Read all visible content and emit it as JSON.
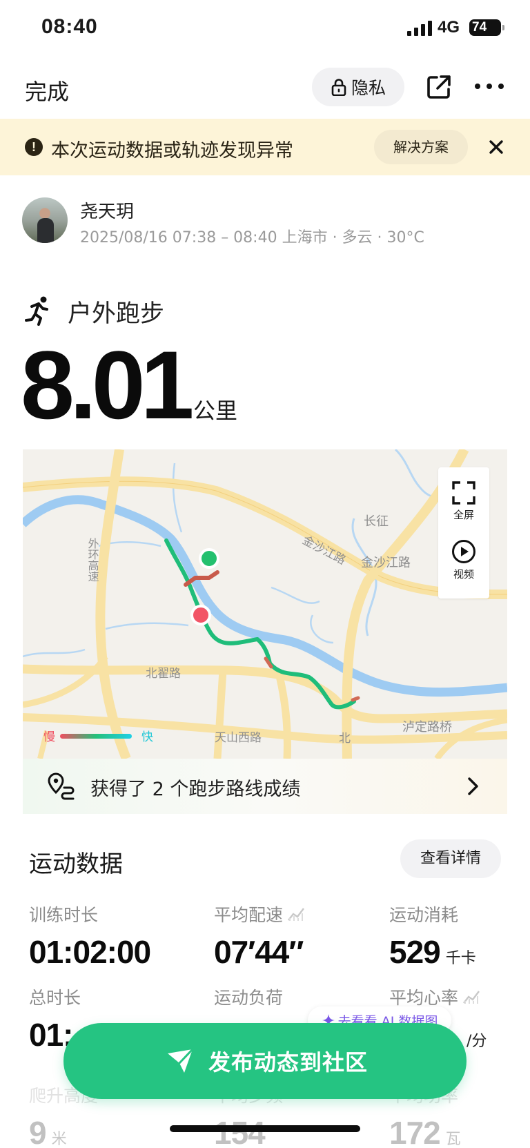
{
  "status_bar": {
    "time": "08:40",
    "network": "4G",
    "battery": "74"
  },
  "nav": {
    "done_label": "完成",
    "privacy_label": "隐私"
  },
  "warning": {
    "text": "本次运动数据或轨迹发现异常",
    "solution_label": "解决方案"
  },
  "user": {
    "name": "尧天玥",
    "meta": "2025/08/16 07:38 – 08:40 上海市 · 多云 · 30°C"
  },
  "activity": {
    "type_label": "户外跑步",
    "distance": "8.01",
    "distance_unit": "公里"
  },
  "map": {
    "fullscreen_label": "全屏",
    "video_label": "视频",
    "speed_slow": "慢",
    "speed_fast": "快",
    "road_labels": {
      "outer_ring": "外环高速",
      "changzheng": "长征",
      "jinshajiang_1": "金沙江路",
      "jinshajiang_2": "金沙江路",
      "beidi": "北翟路",
      "tianshan": "天山西路",
      "beigan": "北",
      "ludingqiao": "泸定路桥"
    },
    "colors": {
      "route": "#1fbd7a",
      "start": "#23c06e",
      "end": "#f25567",
      "road": "#f8e2a4",
      "water": "#9ecbf2"
    }
  },
  "route_achievement": {
    "text": "获得了 2 个跑步路线成绩"
  },
  "stats": {
    "title": "运动数据",
    "details_label": "查看详情",
    "items": [
      {
        "label": "训练时长",
        "value": "01:02:00",
        "unit": ""
      },
      {
        "label": "平均配速",
        "value": "07′44″",
        "unit": ""
      },
      {
        "label": "运动消耗",
        "value": "529",
        "unit": "千卡"
      },
      {
        "label": "总时长",
        "value": "01:",
        "unit": ""
      },
      {
        "label": "运动负荷",
        "value": "",
        "unit": ""
      },
      {
        "label": "平均心率",
        "value": "",
        "unit": "/分"
      },
      {
        "label": "爬升高度",
        "value": "9",
        "unit": "米"
      },
      {
        "label": "平均步频",
        "value": "154",
        "unit": ""
      },
      {
        "label": "平均功率",
        "value": "172",
        "unit": "瓦"
      }
    ]
  },
  "ai_chip": {
    "text": "去看看 AI 数据图"
  },
  "publish": {
    "label": "发布动态到社区"
  }
}
